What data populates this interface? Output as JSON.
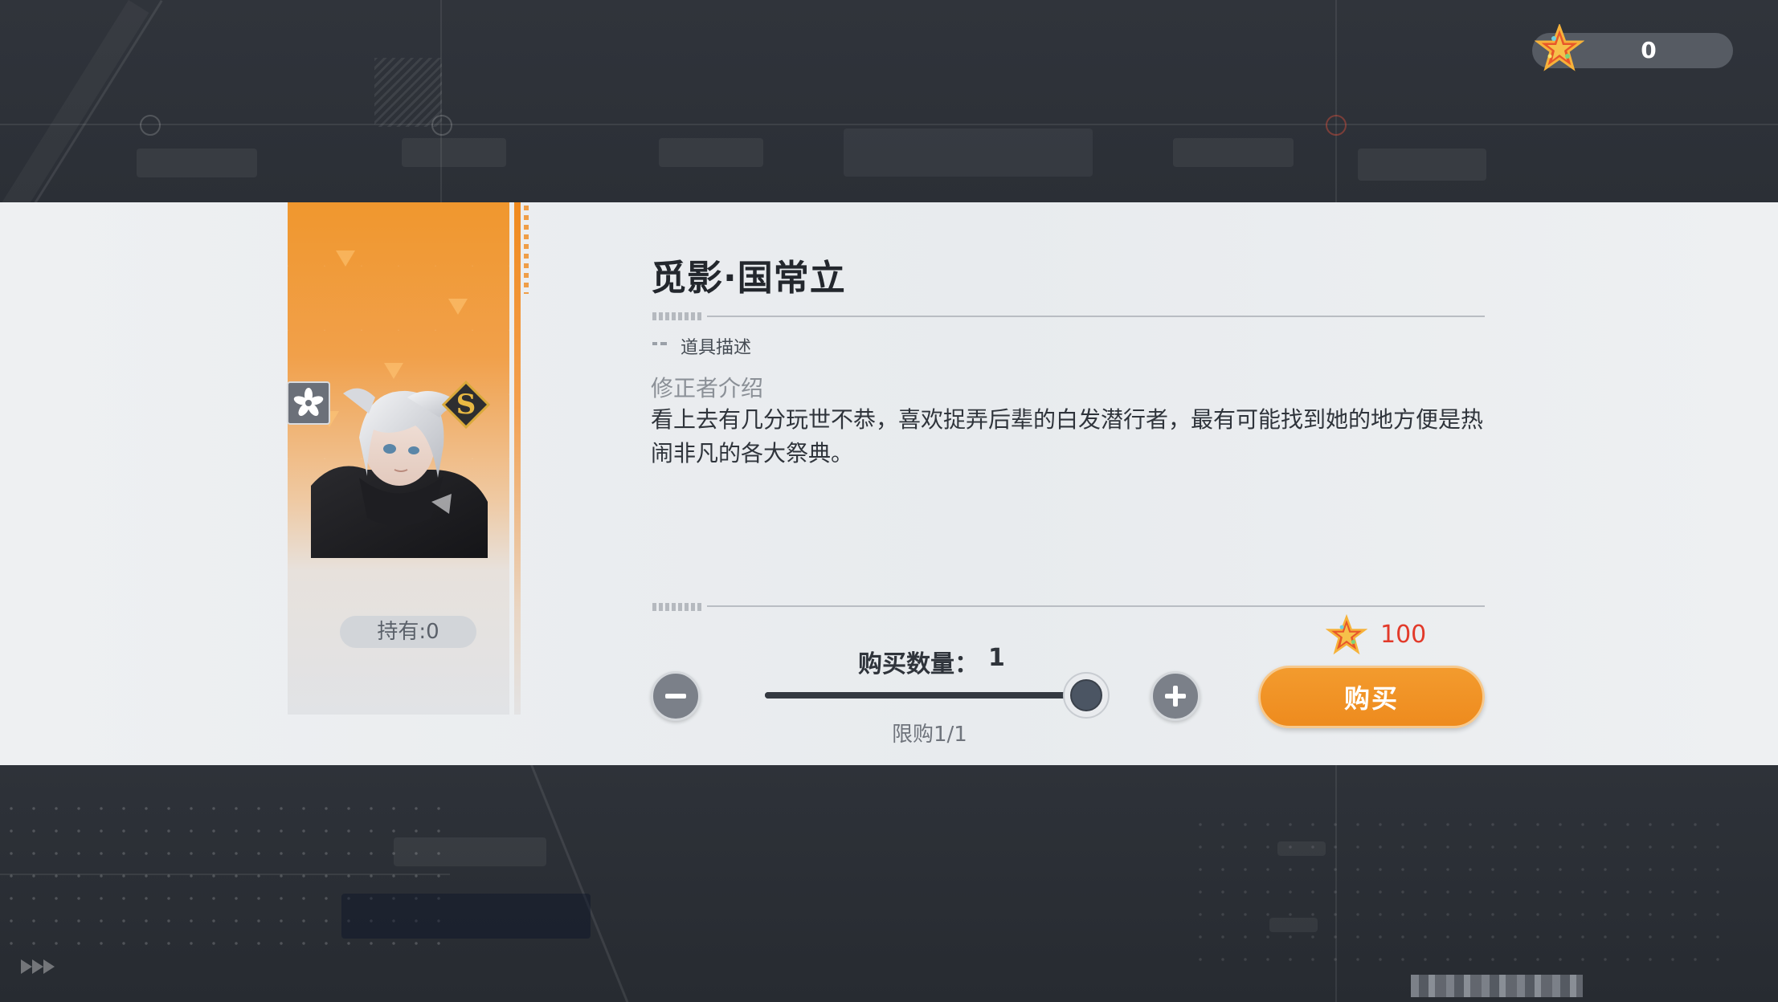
{
  "currency": {
    "icon": "crystal-star-icon",
    "amount": "0"
  },
  "item": {
    "name": "觅影·国常立",
    "section_label": "道具描述",
    "subtitle": "修正者介绍",
    "description": "看上去有几分玩世不恭，喜欢捉弄后辈的白发潜行者，最有可能找到她的地方便是热闹非凡的各大祭典。",
    "owned_label": "持有:0",
    "rank": "S",
    "element_icon": "sakura-element-icon"
  },
  "purchase": {
    "price": "100",
    "price_icon": "crystal-star-icon",
    "quantity_label": "购买数量：",
    "quantity_value": "1",
    "limit_label": "限购1/1",
    "slider_level": 1.0,
    "buy_label": "购买",
    "minus_icon": "minus-icon",
    "plus_icon": "plus-icon"
  },
  "colors": {
    "accent_orange": "#ef8f22",
    "price_red": "#e23a2a",
    "panel": "#eceef0",
    "background": "#2a2e35"
  }
}
